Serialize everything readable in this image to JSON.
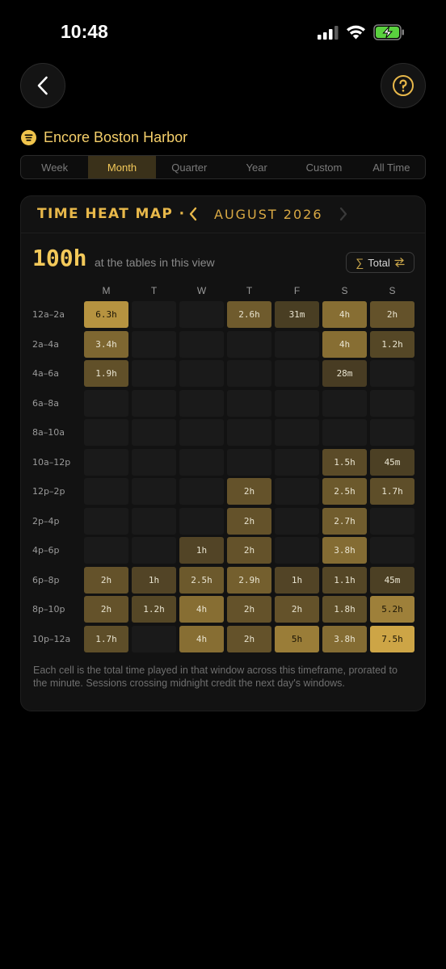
{
  "status": {
    "time": "10:48"
  },
  "venue": {
    "name": "Encore Boston Harbor",
    "icon": "list-icon"
  },
  "segments": [
    {
      "label": "Week",
      "active": false
    },
    {
      "label": "Month",
      "active": true
    },
    {
      "label": "Quarter",
      "active": false
    },
    {
      "label": "Year",
      "active": false
    },
    {
      "label": "Custom",
      "active": false
    },
    {
      "label": "All Time",
      "active": false
    }
  ],
  "heatmap": {
    "title": "TIME HEAT MAP ·",
    "month": "AUGUST 2026",
    "total": "100h",
    "total_sub": "at the tables in this view",
    "toggle_symbol": "∑",
    "toggle_label": "Total",
    "toggle_icon": "swap-arrows-icon",
    "accent": "#f0c44c",
    "days": [
      "M",
      "T",
      "W",
      "T",
      "F",
      "S",
      "S"
    ],
    "rows": [
      {
        "label": "12a–2a",
        "cells": [
          [
            "6.3h",
            0.84
          ],
          [
            "",
            0
          ],
          [
            "",
            0
          ],
          [
            "2.6h",
            0.36
          ],
          [
            "31m",
            0.1
          ],
          [
            "4h",
            0.52
          ],
          [
            "2h",
            0.28
          ]
        ]
      },
      {
        "label": "2a–4a",
        "cells": [
          [
            "3.4h",
            0.46
          ],
          [
            "",
            0
          ],
          [
            "",
            0
          ],
          [
            "",
            0
          ],
          [
            "",
            0
          ],
          [
            "4h",
            0.52
          ],
          [
            "1.2h",
            0.18
          ]
        ]
      },
      {
        "label": "4a–6a",
        "cells": [
          [
            "1.9h",
            0.26
          ],
          [
            "",
            0
          ],
          [
            "",
            0
          ],
          [
            "",
            0
          ],
          [
            "",
            0
          ],
          [
            "28m",
            0.09
          ],
          [
            "",
            0
          ]
        ]
      },
      {
        "label": "6a–8a",
        "cells": [
          [
            "",
            0
          ],
          [
            "",
            0
          ],
          [
            "",
            0
          ],
          [
            "",
            0
          ],
          [
            "",
            0
          ],
          [
            "",
            0
          ],
          [
            "",
            0
          ]
        ]
      },
      {
        "label": "8a–10a",
        "cells": [
          [
            "",
            0
          ],
          [
            "",
            0
          ],
          [
            "",
            0
          ],
          [
            "",
            0
          ],
          [
            "",
            0
          ],
          [
            "",
            0
          ],
          [
            "",
            0
          ]
        ]
      },
      {
        "label": "10a–12p",
        "cells": [
          [
            "",
            0
          ],
          [
            "",
            0
          ],
          [
            "",
            0
          ],
          [
            "",
            0
          ],
          [
            "",
            0
          ],
          [
            "1.5h",
            0.22
          ],
          [
            "45m",
            0.12
          ]
        ]
      },
      {
        "label": "12p–2p",
        "cells": [
          [
            "",
            0
          ],
          [
            "",
            0
          ],
          [
            "",
            0
          ],
          [
            "2h",
            0.28
          ],
          [
            "",
            0
          ],
          [
            "2.5h",
            0.34
          ],
          [
            "1.7h",
            0.24
          ]
        ]
      },
      {
        "label": "2p–4p",
        "cells": [
          [
            "",
            0
          ],
          [
            "",
            0
          ],
          [
            "",
            0
          ],
          [
            "2h",
            0.28
          ],
          [
            "",
            0
          ],
          [
            "2.7h",
            0.37
          ],
          [
            "",
            0
          ]
        ]
      },
      {
        "label": "4p–6p",
        "cells": [
          [
            "",
            0
          ],
          [
            "",
            0
          ],
          [
            "1h",
            0.16
          ],
          [
            "2h",
            0.28
          ],
          [
            "",
            0
          ],
          [
            "3.8h",
            0.5
          ],
          [
            "",
            0
          ]
        ]
      },
      {
        "label": "6p–8p",
        "cells": [
          [
            "2h",
            0.28
          ],
          [
            "1h",
            0.16
          ],
          [
            "2.5h",
            0.34
          ],
          [
            "2.9h",
            0.39
          ],
          [
            "1h",
            0.16
          ],
          [
            "1.1h",
            0.17
          ],
          [
            "45m",
            0.12
          ]
        ]
      },
      {
        "label": "8p–10p",
        "cells": [
          [
            "2h",
            0.28
          ],
          [
            "1.2h",
            0.18
          ],
          [
            "4h",
            0.52
          ],
          [
            "2h",
            0.28
          ],
          [
            "2h",
            0.28
          ],
          [
            "1.8h",
            0.25
          ],
          [
            "5.2h",
            0.68
          ]
        ]
      },
      {
        "label": "10p–12a",
        "cells": [
          [
            "1.7h",
            0.24
          ],
          [
            "",
            0
          ],
          [
            "4h",
            0.52
          ],
          [
            "2h",
            0.28
          ],
          [
            "5h",
            0.65
          ],
          [
            "3.8h",
            0.5
          ],
          [
            "7.5h",
            1.0
          ]
        ]
      }
    ],
    "footnote": "Each cell is the total time played in that window across this timeframe, prorated to the minute. Sessions crossing midnight credit the next day's windows."
  }
}
